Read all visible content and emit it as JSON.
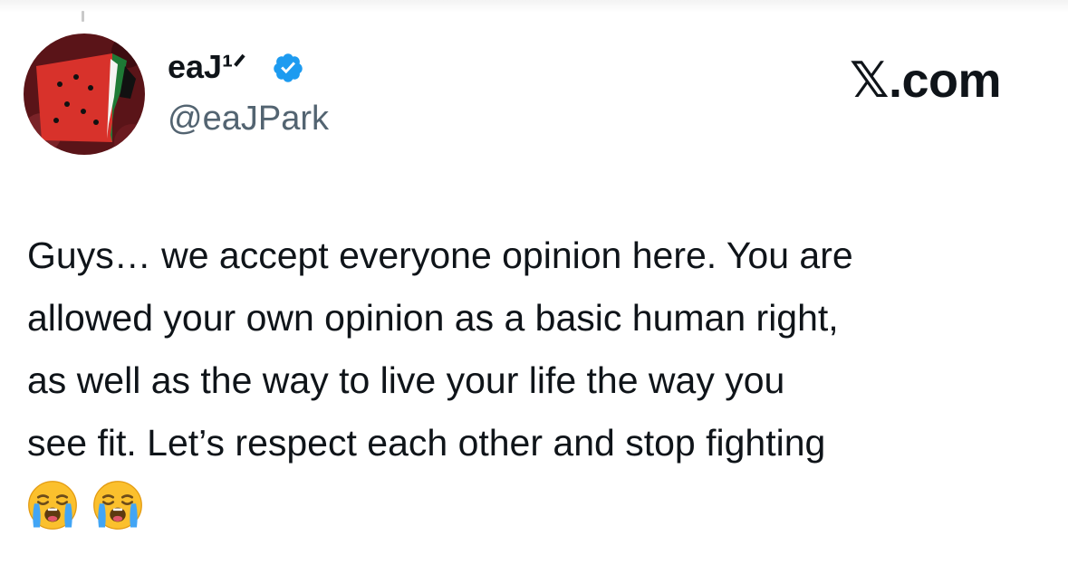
{
  "post": {
    "display_name": "eaJ¹ᐟ",
    "verified": true,
    "handle": "@eaJPark",
    "brand": "𝕏.com",
    "text_lines": [
      "Guys… we accept everyone opinion here. You are",
      "allowed your own opinion as a basic human right,",
      "as well as the way to live your life the way you",
      "see fit. Let’s respect each other and stop fighting"
    ],
    "emojis": [
      "loudly-crying-face",
      "loudly-crying-face"
    ]
  },
  "colors": {
    "verified_blue": "#1d9bf0",
    "handle_gray": "#536471",
    "text": "#0f1419"
  },
  "icons": {
    "avatar": "watermelon-avatar",
    "verified": "verified-badge-icon"
  }
}
